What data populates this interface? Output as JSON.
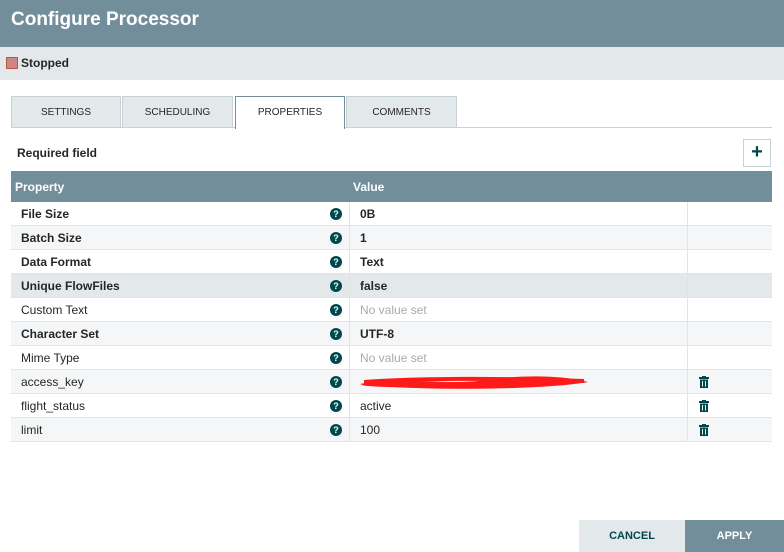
{
  "dialog": {
    "title": "Configure Processor"
  },
  "status": {
    "text": "Stopped",
    "color": "#d18686"
  },
  "tabs": [
    {
      "label": "SETTINGS"
    },
    {
      "label": "SCHEDULING"
    },
    {
      "label": "PROPERTIES"
    },
    {
      "label": "COMMENTS"
    }
  ],
  "properties": {
    "required_label": "Required field",
    "add_icon": "+",
    "columns": {
      "property": "Property",
      "value": "Value"
    },
    "help_icon": "?",
    "rows": [
      {
        "name": "File Size",
        "value": "0B"
      },
      {
        "name": "Batch Size",
        "value": "1"
      },
      {
        "name": "Data Format",
        "value": "Text"
      },
      {
        "name": "Unique FlowFiles",
        "value": "false"
      },
      {
        "name": "Custom Text",
        "value": "No value set"
      },
      {
        "name": "Character Set",
        "value": "UTF-8"
      },
      {
        "name": "Mime Type",
        "value": "No value set"
      },
      {
        "name": "access_key",
        "value": ""
      },
      {
        "name": "flight_status",
        "value": "active"
      },
      {
        "name": "limit",
        "value": "100"
      }
    ]
  },
  "footer": {
    "cancel": "CANCEL",
    "apply": "APPLY"
  },
  "colors": {
    "accent": "#728e9b",
    "dark_teal": "#004849",
    "light_bg": "#e3e8eb"
  }
}
